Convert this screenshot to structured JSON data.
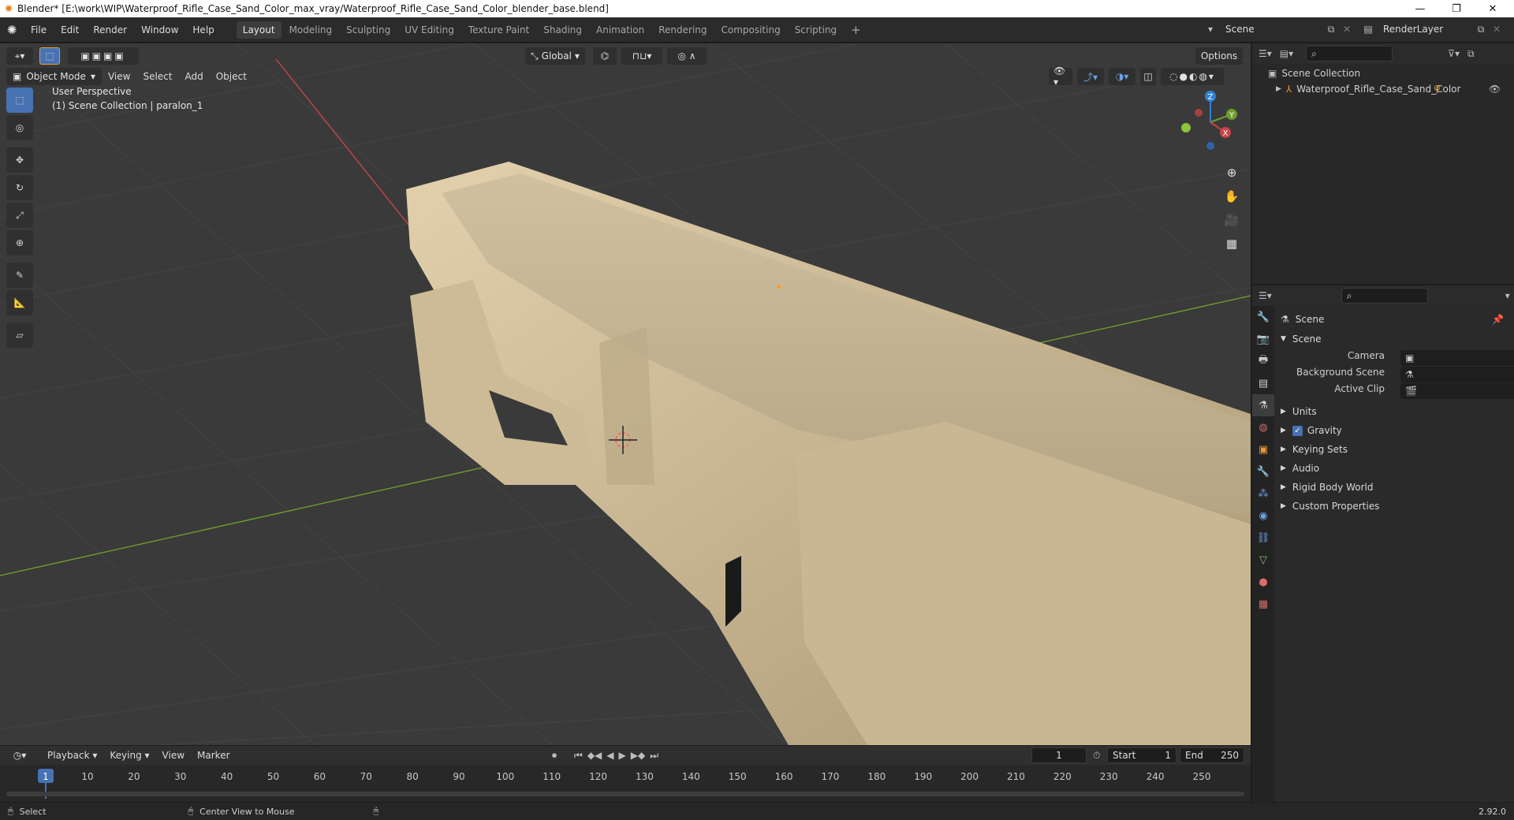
{
  "window": {
    "title": "Blender* [E:\\work\\WIP\\Waterproof_Rifle_Case_Sand_Color_max_vray/Waterproof_Rifle_Case_Sand_Color_blender_base.blend]",
    "minimize": "—",
    "restore": "❐",
    "close": "✕"
  },
  "menubar": {
    "items": [
      "File",
      "Edit",
      "Render",
      "Window",
      "Help"
    ],
    "workspaces": [
      "Layout",
      "Modeling",
      "Sculpting",
      "UV Editing",
      "Texture Paint",
      "Shading",
      "Animation",
      "Rendering",
      "Compositing",
      "Scripting"
    ],
    "active_workspace": "Layout",
    "add_workspace": "+",
    "scene": "Scene",
    "render_layer": "RenderLayer"
  },
  "viewport": {
    "transform_orientation": "Global",
    "options_label": "Options",
    "mode": "Object Mode",
    "menus": [
      "View",
      "Select",
      "Add",
      "Object"
    ],
    "perspective_label": "User Perspective",
    "collection_label": "(1) Scene Collection | paralon_1",
    "gizmo_axes": [
      "Z",
      "Y",
      "X"
    ]
  },
  "outliner": {
    "root": "Scene Collection",
    "item": "Waterproof_Rifle_Case_Sand_Color"
  },
  "properties": {
    "context_title": "Scene",
    "panel_title": "Scene",
    "fields": [
      {
        "label": "Camera",
        "value": ""
      },
      {
        "label": "Background Scene",
        "value": ""
      },
      {
        "label": "Active Clip",
        "value": ""
      }
    ],
    "subpanels": [
      "Units",
      "Gravity",
      "Keying Sets",
      "Audio",
      "Rigid Body World",
      "Custom Properties"
    ],
    "gravity_checked": true
  },
  "timeline": {
    "menus": [
      "Playback",
      "Keying",
      "View",
      "Marker"
    ],
    "current_frame": "1",
    "start_label": "Start",
    "start_value": "1",
    "end_label": "End",
    "end_value": "250",
    "ticks": [
      "1",
      "10",
      "20",
      "30",
      "40",
      "50",
      "60",
      "70",
      "80",
      "90",
      "100",
      "110",
      "120",
      "130",
      "140",
      "150",
      "160",
      "170",
      "180",
      "190",
      "200",
      "210",
      "220",
      "230",
      "240",
      "250"
    ]
  },
  "statusbar": {
    "left": "Select",
    "middle": "Center View to Mouse",
    "version": "2.92.0"
  },
  "colors": {
    "accent": "#4772b3",
    "case_body": "#d8c6a4",
    "x_axis": "#c84545",
    "y_axis": "#6e9c2e",
    "z_axis": "#2f82d8",
    "active_workspace": "#3d3d3d"
  }
}
